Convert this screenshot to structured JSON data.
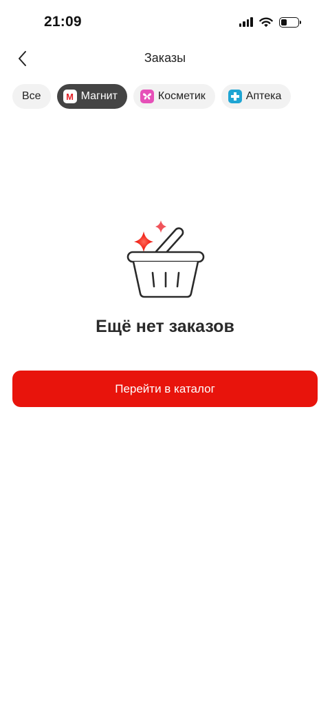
{
  "status_bar": {
    "time": "21:09",
    "icons": [
      "signal-icon",
      "wifi-icon",
      "battery-icon"
    ],
    "battery_level": 0.35
  },
  "header": {
    "title": "Заказы",
    "back_icon": "chevron-left-icon"
  },
  "filters": {
    "selected": "Магнит",
    "chips": [
      {
        "label": "Все",
        "icon": null
      },
      {
        "label": "Магнит",
        "icon": "magnit-logo-icon",
        "icon_letter": "M"
      },
      {
        "label": "Косметик",
        "icon": "butterfly-icon"
      },
      {
        "label": "Аптека",
        "icon": "medical-cross-icon"
      }
    ]
  },
  "empty_state": {
    "illustration": "basket-with-sparkles-icon",
    "title": "Ещё нет заказов",
    "button_label": "Перейти в каталог"
  },
  "colors": {
    "accent": "#e8140c",
    "chip_active_bg": "#444444",
    "chip_bg": "#f2f2f2",
    "cosmetic_icon": "#e650b8",
    "pharmacy_icon": "#1fa5d3"
  }
}
